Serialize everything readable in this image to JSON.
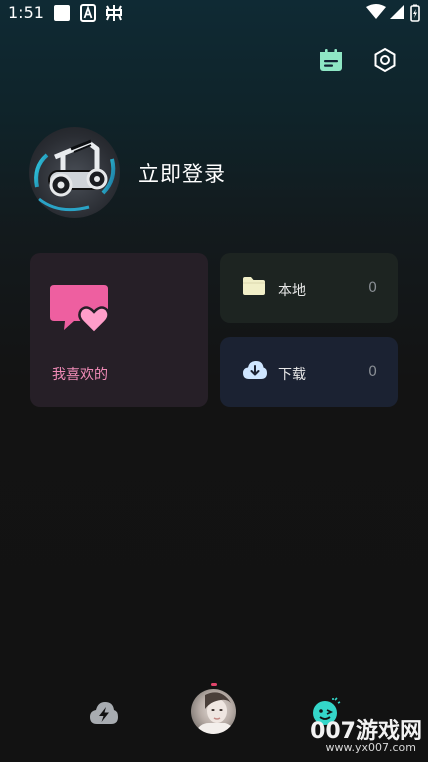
{
  "status_bar": {
    "time": "1:51",
    "icons": [
      "square-icon",
      "a-box-icon",
      "bug-icon",
      "wifi-icon",
      "signal-icon",
      "battery-charging-icon"
    ]
  },
  "header": {
    "actions": [
      {
        "name": "calendar-icon",
        "color": "#8ee6c4"
      },
      {
        "name": "settings-icon",
        "color": "#ffffff"
      }
    ]
  },
  "profile": {
    "login_text": "立即登录"
  },
  "cards": {
    "favorites": {
      "label": "我喜欢的",
      "icon": "heart-chat-icon",
      "label_color": "#f08bb7"
    },
    "local": {
      "label": "本地",
      "count": "0",
      "icon": "folder-icon"
    },
    "download": {
      "label": "下载",
      "count": "0",
      "icon": "cloud-download-icon"
    }
  },
  "bottom_nav": {
    "items": [
      {
        "name": "lightning-cloud-icon"
      },
      {
        "name": "now-playing-avatar"
      },
      {
        "name": "emoji-icon",
        "color": "#34d6c9"
      }
    ]
  },
  "watermark": {
    "text": "007游戏网",
    "sub": "www.yx007.com"
  }
}
